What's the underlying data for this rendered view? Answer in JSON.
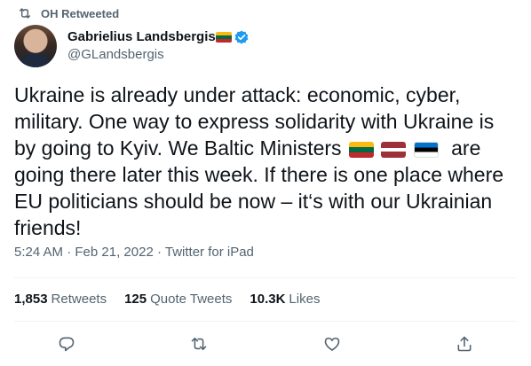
{
  "retweet_context": {
    "label": "OH Retweeted",
    "icon": "retweet-icon"
  },
  "author": {
    "display_name": "Gabrielius Landsbergis",
    "handle": "@GLandsbergis",
    "name_flag": "lithuania-flag",
    "verified_icon": "verified-badge-icon"
  },
  "tweet": {
    "text_part1": "Ukraine is already under attack: economic, cyber, military. One way to express solidarity with Ukraine is by going to Kyiv. We Baltic Ministers",
    "flags": [
      "lithuania-flag",
      "latvia-flag",
      "estonia-flag"
    ],
    "text_part2": " are going there later this week. If there is one place where EU politicians should be now – it‘s with our Ukrainian friends!"
  },
  "meta": {
    "time": "5:24 AM",
    "separator1": " · ",
    "date": "Feb 21, 2022",
    "separator2": " · ",
    "source": "Twitter for iPad"
  },
  "stats": {
    "retweets_count": "1,853",
    "retweets_label": "Retweets",
    "quotes_count": "125",
    "quotes_label": "Quote Tweets",
    "likes_count": "10.3K",
    "likes_label": "Likes"
  },
  "actions": [
    "reply-icon",
    "retweet-icon",
    "like-icon",
    "share-icon"
  ],
  "colors": {
    "text": "#0f1419",
    "secondary": "#536471",
    "verified": "#1d9bf0",
    "divider": "#eff3f4"
  }
}
